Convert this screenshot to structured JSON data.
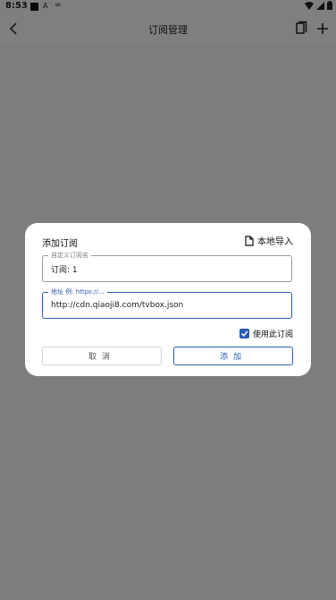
{
  "status_bar": {
    "time": "8:53",
    "app_letter": "A"
  },
  "app_bar": {
    "title": "订阅管理"
  },
  "dialog": {
    "title": "添加订阅",
    "import_label": "本地导入",
    "name_field": {
      "label": "自定义订阅名",
      "value": "订阅: 1"
    },
    "url_field": {
      "label": "地址 例: https://...",
      "value": "http://cdn.qiaoji8.com/tvbox.json"
    },
    "use_checkbox": {
      "label": "使用此订阅",
      "checked": true
    },
    "cancel_label": "取消",
    "add_label": "添加"
  },
  "colors": {
    "accent": "#2f5bb0",
    "scrim": "#7f7f7f"
  }
}
